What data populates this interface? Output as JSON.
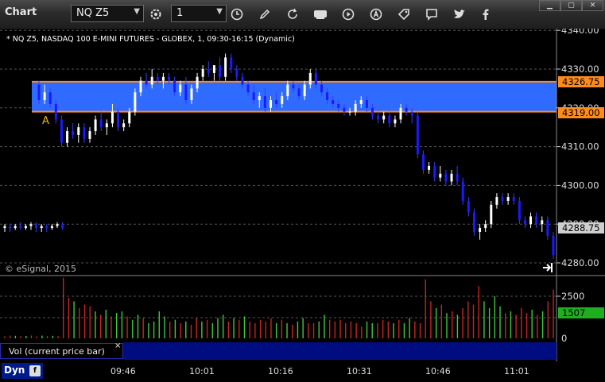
{
  "toolbar": {
    "title": "Chart",
    "symbol": "NQ Z5",
    "interval": "1",
    "icons": [
      "settings-icon",
      "clock-icon",
      "pencil-icon",
      "refresh-icon",
      "get-icon",
      "play-icon",
      "text-icon",
      "tag-icon",
      "comment-icon",
      "twitter-icon",
      "facebook-icon"
    ]
  },
  "chart": {
    "header": "* NQ Z5, NASDAQ 100 E-MINI FUTURES - GLOBEX, 1, 09:30-16:15 (Dynamic)",
    "copyright": "© eSignal, 2015",
    "marker_label": "A",
    "price_labels": [
      "4340.00",
      "4330.00",
      "4320.00",
      "4310.00",
      "4300.00",
      "4290.00",
      "4280.00"
    ],
    "band_upper_label": "4326.75",
    "band_lower_label": "4319.00",
    "last_price_label": "4288.75",
    "volume_labels": [
      "2500",
      "0"
    ],
    "volume_last_label": "1507",
    "volume_panel_title": "Vol (current price bar)",
    "close_symbol": "×",
    "time_labels": [
      "09:46",
      "10:01",
      "10:16",
      "10:31",
      "10:46",
      "11:01"
    ],
    "dyn_label": "Dyn",
    "dyn_icon": "f"
  },
  "colors": {
    "band": "#2f6bff",
    "band_line": "#ff8c1a",
    "up_candle": "#ffffff",
    "down_candle": "#1a1aff",
    "volume_up": "#3ccc3c",
    "volume_down": "#cc2222",
    "last_price_bg": "#cfcfcf",
    "volume_last_bg": "#1fae1f",
    "bottom_bar": "#001a8c"
  },
  "chart_data": {
    "type": "candlestick",
    "ylim": [
      4276,
      4341
    ],
    "band": {
      "upper": 4326.75,
      "lower": 4319.0
    },
    "candles": [
      [
        4289,
        4290,
        4288,
        4289.5
      ],
      [
        4289.5,
        4290,
        4288,
        4289
      ],
      [
        4289,
        4290,
        4288.5,
        4289.5
      ],
      [
        4289.5,
        4290.5,
        4288.5,
        4289
      ],
      [
        4289,
        4290,
        4288.5,
        4289.5
      ],
      [
        4289.5,
        4290.5,
        4288.5,
        4290
      ],
      [
        4290,
        4290.5,
        4288,
        4289
      ],
      [
        4289,
        4290,
        4288,
        4289.5
      ],
      [
        4289.5,
        4290,
        4288,
        4289
      ],
      [
        4289,
        4290,
        4288.5,
        4289.5
      ],
      [
        4289.5,
        4290.5,
        4289,
        4290
      ],
      [
        4290,
        4290.5,
        4288.5,
        4289
      ],
      [
        4326,
        4327,
        4321,
        4322
      ],
      [
        4322,
        4326,
        4321,
        4324
      ],
      [
        4324,
        4325,
        4320,
        4321
      ],
      [
        4321,
        4322,
        4316,
        4317
      ],
      [
        4317,
        4318,
        4310,
        4311
      ],
      [
        4311,
        4315,
        4310,
        4314
      ],
      [
        4314,
        4316,
        4312,
        4313
      ],
      [
        4313,
        4316,
        4311,
        4315
      ],
      [
        4315,
        4316,
        4311,
        4312
      ],
      [
        4312,
        4315,
        4311,
        4314
      ],
      [
        4314,
        4318,
        4313,
        4317
      ],
      [
        4317,
        4319,
        4314,
        4315
      ],
      [
        4315,
        4317,
        4313,
        4316
      ],
      [
        4316,
        4321,
        4315,
        4319
      ],
      [
        4319,
        4320,
        4314,
        4315
      ],
      [
        4315,
        4317,
        4314,
        4316
      ],
      [
        4316,
        4320,
        4315,
        4319
      ],
      [
        4319,
        4325,
        4318,
        4324
      ],
      [
        4324,
        4328,
        4323,
        4327
      ],
      [
        4327,
        4329,
        4325,
        4326
      ],
      [
        4326,
        4330,
        4325,
        4328
      ],
      [
        4328,
        4329,
        4326,
        4327
      ],
      [
        4327,
        4329,
        4325,
        4328
      ],
      [
        4328,
        4329,
        4326,
        4327
      ],
      [
        4327,
        4328,
        4323,
        4324
      ],
      [
        4324,
        4327,
        4323,
        4326
      ],
      [
        4326,
        4328,
        4321,
        4322
      ],
      [
        4322,
        4326,
        4321,
        4325
      ],
      [
        4325,
        4329,
        4324,
        4328
      ],
      [
        4328,
        4331,
        4327,
        4330
      ],
      [
        4330,
        4332,
        4328,
        4329
      ],
      [
        4329,
        4331,
        4327,
        4331
      ],
      [
        4331,
        4333,
        4327,
        4328
      ],
      [
        4328,
        4334,
        4327,
        4333
      ],
      [
        4333,
        4334,
        4329,
        4330
      ],
      [
        4330,
        4331,
        4327,
        4328
      ],
      [
        4328,
        4329,
        4325,
        4326
      ],
      [
        4326,
        4327,
        4323,
        4324
      ],
      [
        4324,
        4326,
        4321,
        4322
      ],
      [
        4322,
        4324,
        4320,
        4323
      ],
      [
        4323,
        4325,
        4319,
        4320
      ],
      [
        4320,
        4323,
        4319,
        4322
      ],
      [
        4322,
        4324,
        4320,
        4321
      ],
      [
        4321,
        4324,
        4320,
        4323
      ],
      [
        4323,
        4327,
        4322,
        4326
      ],
      [
        4326,
        4327,
        4324,
        4325
      ],
      [
        4325,
        4326,
        4322,
        4323
      ],
      [
        4323,
        4327,
        4322,
        4326
      ],
      [
        4326,
        4330,
        4325,
        4329
      ],
      [
        4329,
        4330,
        4325,
        4326
      ],
      [
        4326,
        4327,
        4323,
        4324
      ],
      [
        4324,
        4325,
        4321,
        4322
      ],
      [
        4322,
        4323,
        4320,
        4321
      ],
      [
        4321,
        4322,
        4319,
        4320
      ],
      [
        4320,
        4321,
        4318,
        4319
      ],
      [
        4319,
        4320,
        4318,
        4319
      ],
      [
        4319,
        4322,
        4318,
        4321
      ],
      [
        4321,
        4323,
        4320,
        4322
      ],
      [
        4322,
        4323,
        4319,
        4320
      ],
      [
        4320,
        4321,
        4317,
        4318
      ],
      [
        4318,
        4319,
        4316,
        4317
      ],
      [
        4317,
        4319,
        4316,
        4318
      ],
      [
        4318,
        4319,
        4315,
        4316
      ],
      [
        4316,
        4318,
        4315,
        4317
      ],
      [
        4317,
        4321,
        4316,
        4320
      ],
      [
        4320,
        4321,
        4318,
        4319
      ],
      [
        4319,
        4320,
        4316,
        4318
      ],
      [
        4318,
        4319,
        4307,
        4308
      ],
      [
        4308,
        4309,
        4303,
        4304
      ],
      [
        4304,
        4306,
        4303,
        4305
      ],
      [
        4305,
        4306,
        4301,
        4302
      ],
      [
        4302,
        4305,
        4301,
        4303
      ],
      [
        4303,
        4304,
        4300,
        4301
      ],
      [
        4301,
        4304,
        4300,
        4303
      ],
      [
        4303,
        4305,
        4300,
        4301
      ],
      [
        4301,
        4302,
        4295,
        4296
      ],
      [
        4296,
        4297,
        4292,
        4293
      ],
      [
        4293,
        4294,
        4287,
        4288
      ],
      [
        4288,
        4290,
        4286,
        4289
      ],
      [
        4289,
        4291,
        4288,
        4290
      ],
      [
        4290,
        4296,
        4289,
        4295
      ],
      [
        4295,
        4298,
        4294,
        4297
      ],
      [
        4297,
        4298,
        4295,
        4296
      ],
      [
        4296,
        4298,
        4295,
        4297
      ],
      [
        4297,
        4298,
        4295,
        4296
      ],
      [
        4296,
        4297,
        4290,
        4291
      ],
      [
        4291,
        4292,
        4289,
        4290
      ],
      [
        4290,
        4293,
        4289,
        4292
      ],
      [
        4292,
        4293,
        4289,
        4290
      ],
      [
        4290,
        4292,
        4288,
        4291
      ],
      [
        4291,
        4292,
        4286,
        4287
      ],
      [
        4287,
        4288,
        4281,
        4282
      ]
    ],
    "volumes": [
      [
        120,
        "d"
      ],
      [
        160,
        "d"
      ],
      [
        150,
        "u"
      ],
      [
        130,
        "d"
      ],
      [
        140,
        "u"
      ],
      [
        170,
        "d"
      ],
      [
        110,
        "d"
      ],
      [
        160,
        "u"
      ],
      [
        140,
        "d"
      ],
      [
        150,
        "u"
      ],
      [
        130,
        "d"
      ],
      [
        3600,
        "d"
      ],
      [
        2400,
        "d"
      ],
      [
        2200,
        "u"
      ],
      [
        1800,
        "d"
      ],
      [
        2000,
        "d"
      ],
      [
        1900,
        "d"
      ],
      [
        1600,
        "u"
      ],
      [
        1400,
        "d"
      ],
      [
        1700,
        "u"
      ],
      [
        1300,
        "d"
      ],
      [
        1500,
        "u"
      ],
      [
        1600,
        "u"
      ],
      [
        1300,
        "d"
      ],
      [
        1100,
        "u"
      ],
      [
        1400,
        "u"
      ],
      [
        1200,
        "d"
      ],
      [
        900,
        "u"
      ],
      [
        1000,
        "u"
      ],
      [
        1600,
        "u"
      ],
      [
        1300,
        "u"
      ],
      [
        1000,
        "d"
      ],
      [
        1100,
        "u"
      ],
      [
        900,
        "d"
      ],
      [
        1000,
        "u"
      ],
      [
        800,
        "d"
      ],
      [
        1200,
        "d"
      ],
      [
        1000,
        "u"
      ],
      [
        1100,
        "d"
      ],
      [
        900,
        "u"
      ],
      [
        1200,
        "u"
      ],
      [
        1400,
        "u"
      ],
      [
        1000,
        "d"
      ],
      [
        1200,
        "u"
      ],
      [
        1100,
        "d"
      ],
      [
        1300,
        "u"
      ],
      [
        1000,
        "d"
      ],
      [
        900,
        "d"
      ],
      [
        1100,
        "d"
      ],
      [
        1000,
        "d"
      ],
      [
        1200,
        "d"
      ],
      [
        900,
        "u"
      ],
      [
        1100,
        "d"
      ],
      [
        900,
        "u"
      ],
      [
        800,
        "d"
      ],
      [
        1000,
        "u"
      ],
      [
        1200,
        "u"
      ],
      [
        900,
        "d"
      ],
      [
        900,
        "d"
      ],
      [
        1000,
        "u"
      ],
      [
        1400,
        "u"
      ],
      [
        1100,
        "d"
      ],
      [
        1000,
        "d"
      ],
      [
        1100,
        "d"
      ],
      [
        900,
        "d"
      ],
      [
        1000,
        "d"
      ],
      [
        900,
        "d"
      ],
      [
        700,
        "d"
      ],
      [
        1000,
        "u"
      ],
      [
        900,
        "u"
      ],
      [
        900,
        "d"
      ],
      [
        1100,
        "d"
      ],
      [
        1000,
        "d"
      ],
      [
        900,
        "u"
      ],
      [
        1100,
        "d"
      ],
      [
        900,
        "u"
      ],
      [
        1200,
        "u"
      ],
      [
        1000,
        "d"
      ],
      [
        900,
        "d"
      ],
      [
        3500,
        "d"
      ],
      [
        2200,
        "d"
      ],
      [
        1800,
        "u"
      ],
      [
        2000,
        "d"
      ],
      [
        1500,
        "u"
      ],
      [
        1600,
        "d"
      ],
      [
        1400,
        "u"
      ],
      [
        1800,
        "d"
      ],
      [
        2200,
        "d"
      ],
      [
        2000,
        "d"
      ],
      [
        3100,
        "d"
      ],
      [
        2200,
        "u"
      ],
      [
        1800,
        "u"
      ],
      [
        2500,
        "u"
      ],
      [
        1900,
        "u"
      ],
      [
        1500,
        "d"
      ],
      [
        1600,
        "u"
      ],
      [
        1400,
        "d"
      ],
      [
        1800,
        "d"
      ],
      [
        1500,
        "d"
      ],
      [
        1700,
        "u"
      ],
      [
        1400,
        "d"
      ],
      [
        1600,
        "u"
      ],
      [
        2200,
        "d"
      ],
      [
        2900,
        "d"
      ]
    ]
  }
}
